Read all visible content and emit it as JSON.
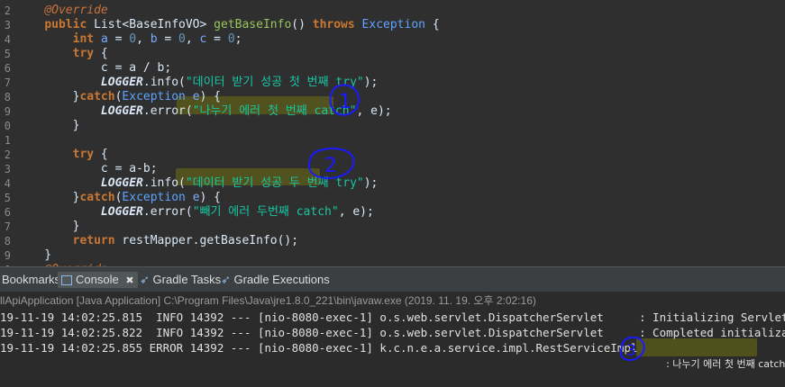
{
  "editor": {
    "lines": [
      {
        "num": "2",
        "parts": [
          [
            "    ",
            ""
          ],
          [
            "@Override",
            "ann"
          ]
        ]
      },
      {
        "num": "3",
        "parts": [
          [
            "    ",
            ""
          ],
          [
            "public",
            "kw"
          ],
          [
            " ",
            ""
          ],
          [
            "List<BaseInfoVO>",
            "typ"
          ],
          [
            " ",
            ""
          ],
          [
            "getBaseInfo",
            "fn"
          ],
          [
            "() ",
            ""
          ],
          [
            "throws",
            "kw"
          ],
          [
            " ",
            ""
          ],
          [
            "Exception",
            "ty"
          ],
          [
            " {",
            ""
          ]
        ]
      },
      {
        "num": "4",
        "parts": [
          [
            "        ",
            ""
          ],
          [
            "int",
            "kw"
          ],
          [
            " ",
            ""
          ],
          [
            "a",
            "var"
          ],
          [
            " = ",
            ""
          ],
          [
            "0",
            "num"
          ],
          [
            ", ",
            ""
          ],
          [
            "b",
            "var"
          ],
          [
            " = ",
            ""
          ],
          [
            "0",
            "num"
          ],
          [
            ", ",
            ""
          ],
          [
            "c",
            "var"
          ],
          [
            " = ",
            ""
          ],
          [
            "0",
            "num"
          ],
          [
            ";",
            ""
          ]
        ]
      },
      {
        "num": "5",
        "parts": [
          [
            "        ",
            ""
          ],
          [
            "try",
            "kw"
          ],
          [
            " {",
            ""
          ]
        ]
      },
      {
        "num": "6",
        "parts": [
          [
            "            c = a / b;",
            ""
          ]
        ]
      },
      {
        "num": "7",
        "parts": [
          [
            "            ",
            ""
          ],
          [
            "LOGGER",
            "logger"
          ],
          [
            ".info(",
            ""
          ],
          [
            "\"데이터 받기 성공 첫 번째 try\"",
            "str"
          ],
          [
            ");",
            ""
          ]
        ]
      },
      {
        "num": "8",
        "parts": [
          [
            "        }",
            ""
          ],
          [
            "catch",
            "kw"
          ],
          [
            "(",
            ""
          ],
          [
            "Exception",
            "ty"
          ],
          [
            " ",
            ""
          ],
          [
            "e",
            "var"
          ],
          [
            ") {",
            ""
          ]
        ]
      },
      {
        "num": "9",
        "parts": [
          [
            "            ",
            ""
          ],
          [
            "LOGGER",
            "logger"
          ],
          [
            ".error(",
            ""
          ],
          [
            "\"나누기 에러 첫 번째 catch\"",
            "str"
          ],
          [
            ", e);",
            ""
          ]
        ]
      },
      {
        "num": "0",
        "parts": [
          [
            "        }",
            ""
          ]
        ]
      },
      {
        "num": "1",
        "parts": [
          [
            "",
            ""
          ]
        ]
      },
      {
        "num": "2",
        "parts": [
          [
            "        ",
            ""
          ],
          [
            "try",
            "kw"
          ],
          [
            " {",
            ""
          ]
        ]
      },
      {
        "num": "3",
        "parts": [
          [
            "            c = a-b;",
            ""
          ]
        ]
      },
      {
        "num": "4",
        "parts": [
          [
            "            ",
            ""
          ],
          [
            "LOGGER",
            "logger"
          ],
          [
            ".info(",
            ""
          ],
          [
            "\"데이터 받기 성공 두 번째 try\"",
            "str"
          ],
          [
            ");",
            ""
          ]
        ]
      },
      {
        "num": "5",
        "parts": [
          [
            "        }",
            ""
          ],
          [
            "catch",
            "kw"
          ],
          [
            "(",
            ""
          ],
          [
            "Exception",
            "ty"
          ],
          [
            " ",
            ""
          ],
          [
            "e",
            "var"
          ],
          [
            ") {",
            ""
          ]
        ]
      },
      {
        "num": "6",
        "parts": [
          [
            "            ",
            ""
          ],
          [
            "LOGGER",
            "logger"
          ],
          [
            ".error(",
            ""
          ],
          [
            "\"빼기 에러 두번째 catch\"",
            "str"
          ],
          [
            ", e);",
            ""
          ]
        ]
      },
      {
        "num": "7",
        "parts": [
          [
            "        }",
            ""
          ]
        ]
      },
      {
        "num": "8",
        "parts": [
          [
            "        ",
            ""
          ],
          [
            "return",
            "kw"
          ],
          [
            " restMapper.getBaseInfo();",
            ""
          ]
        ]
      },
      {
        "num": "9",
        "parts": [
          [
            "    }",
            ""
          ]
        ]
      },
      {
        "num": "0",
        "parts": [
          [
            "    ",
            ""
          ],
          [
            "@Override",
            "ann"
          ]
        ]
      }
    ]
  },
  "annotations": {
    "one": "1",
    "two": "2",
    "three": "3"
  },
  "tabs": {
    "bookmarks": "Bookmarks",
    "console": "Console",
    "console_close": "✖",
    "gradle_tasks": "Gradle Tasks",
    "gradle_executions": "Gradle Executions"
  },
  "console": {
    "path": "llApiApplication [Java Application] C:\\Program Files\\Java\\jre1.8.0_221\\bin\\javaw.exe (2019. 11. 19. 오후 2:02:16)",
    "lines": [
      {
        "prefix": "19-11-19 14:02:25.815  INFO 14392 --- [nio-8080-exec-1] o.s.web.servlet.DispatcherServlet",
        "msg": ": Initializing Servlet 'd"
      },
      {
        "prefix": "19-11-19 14:02:25.822  INFO 14392 --- [nio-8080-exec-1] o.s.web.servlet.DispatcherServlet",
        "msg": ": Completed initializatio"
      },
      {
        "prefix": "19-11-19 14:02:25.855 ERROR 14392 --- [nio-8080-exec-1] k.c.n.e.a.service.impl.RestServiceImpl",
        "msg": ": 나누기 에러 첫 번째 catch"
      }
    ]
  },
  "colors": {
    "highlight": "#969600",
    "ink": "#1a1aff"
  }
}
